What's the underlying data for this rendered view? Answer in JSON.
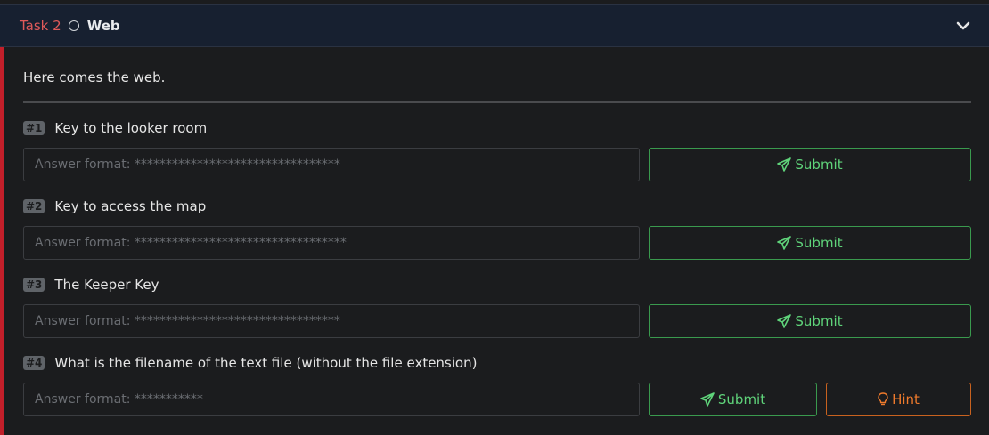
{
  "task": {
    "number_label": "Task 2",
    "title": "Web",
    "description": "Here comes the web."
  },
  "questions": [
    {
      "badge": "#1",
      "text": "Key to the looker room",
      "placeholder": "Answer format: *********************************",
      "submit_label": "Submit"
    },
    {
      "badge": "#2",
      "text": "Key to access the map",
      "placeholder": "Answer format: **********************************",
      "submit_label": "Submit"
    },
    {
      "badge": "#3",
      "text": "The Keeper Key",
      "placeholder": "Answer format: *********************************",
      "submit_label": "Submit"
    },
    {
      "badge": "#4",
      "text": "What is the filename of the text file (without the file extension)",
      "placeholder": "Answer format: ***********",
      "submit_label": "Submit",
      "hint_label": "Hint"
    }
  ],
  "colors": {
    "accent_red": "#c21f2a",
    "header_bg": "#172030",
    "submit_green": "#5fd37a",
    "hint_orange": "#ef7a2c"
  },
  "icons": {
    "status": "circle-icon",
    "collapse": "chevron-down-icon",
    "submit": "paper-plane-icon",
    "hint": "lightbulb-icon"
  }
}
